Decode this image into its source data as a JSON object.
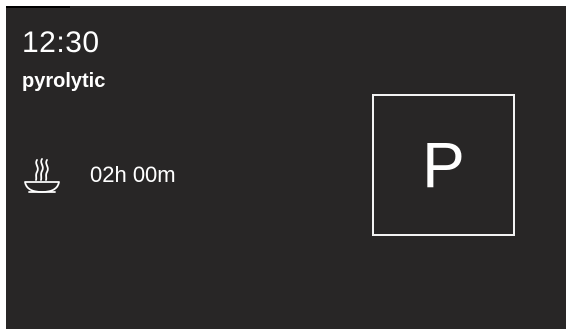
{
  "display": {
    "time": "12:30",
    "mode": "pyrolytic",
    "duration": "02h 00m",
    "program_symbol": "P",
    "duration_icon": "cooking-pan-with-steam-icon"
  },
  "colors": {
    "screen_background": "#282626",
    "text": "#ffffff"
  }
}
